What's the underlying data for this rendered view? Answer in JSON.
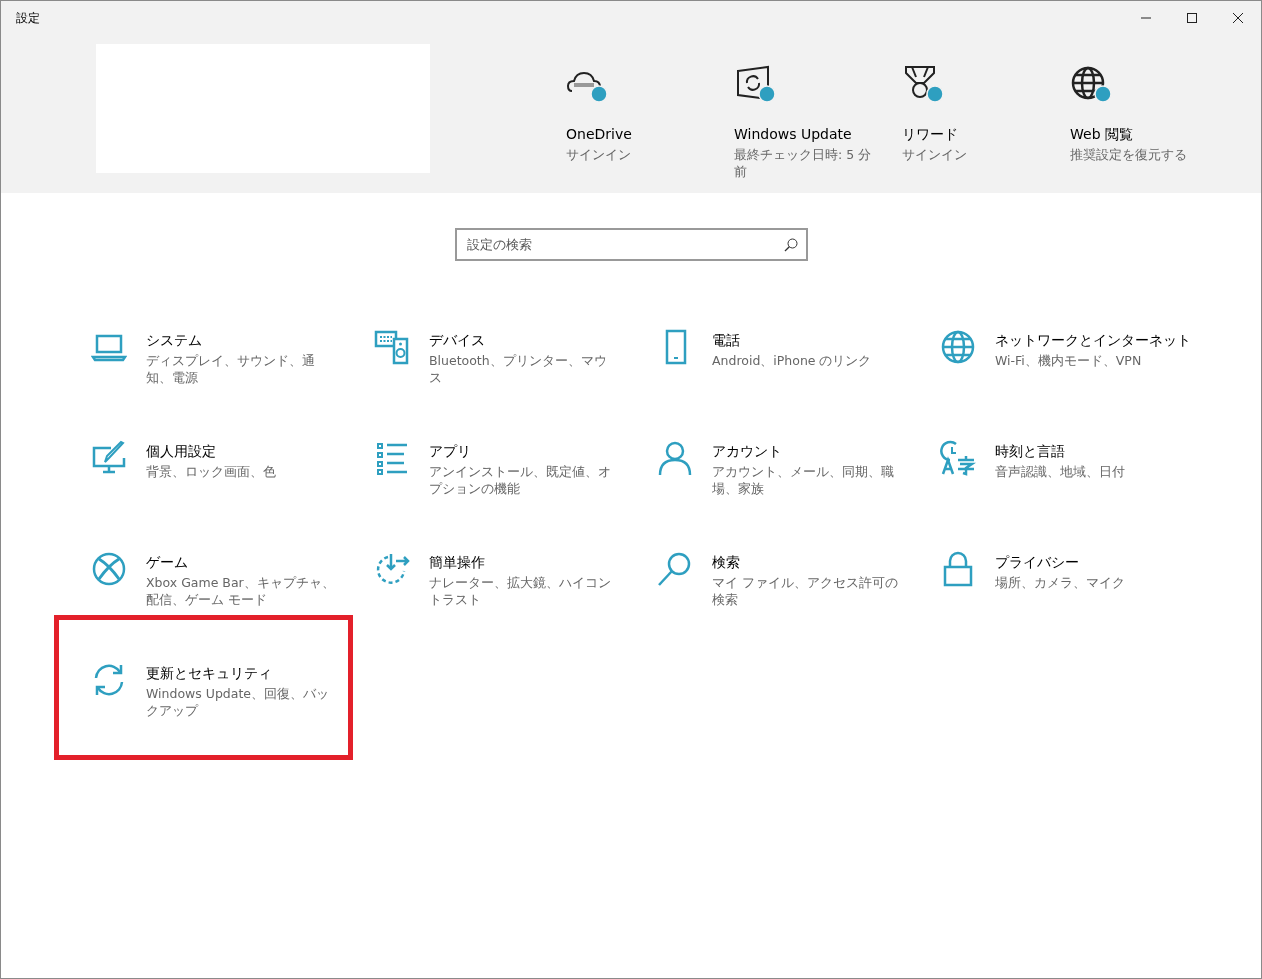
{
  "window": {
    "title": "設定"
  },
  "header_tiles": [
    {
      "kind": "cloud",
      "title": "OneDrive",
      "subtitle": "サインイン"
    },
    {
      "kind": "update",
      "title": "Windows Update",
      "subtitle": "最終チェック日時: 5 分前"
    },
    {
      "kind": "medal",
      "title": "リワード",
      "subtitle": "サインイン"
    },
    {
      "kind": "globe",
      "title": "Web 閲覧",
      "subtitle": "推奨設定を復元する"
    }
  ],
  "search": {
    "placeholder": "設定の検索"
  },
  "categories": [
    {
      "kind": "laptop",
      "title": "システム",
      "subtitle": "ディスプレイ、サウンド、通知、電源",
      "highlighted": false
    },
    {
      "kind": "devices",
      "title": "デバイス",
      "subtitle": "Bluetooth、プリンター、マウス",
      "highlighted": false
    },
    {
      "kind": "phone",
      "title": "電話",
      "subtitle": "Android、iPhone のリンク",
      "highlighted": false
    },
    {
      "kind": "globe",
      "title": "ネットワークとインターネット",
      "subtitle": "Wi-Fi、機内モード、VPN",
      "highlighted": false
    },
    {
      "kind": "paint",
      "title": "個人用設定",
      "subtitle": "背景、ロック画面、色",
      "highlighted": false
    },
    {
      "kind": "list",
      "title": "アプリ",
      "subtitle": "アンインストール、既定値、オプションの機能",
      "highlighted": false
    },
    {
      "kind": "person",
      "title": "アカウント",
      "subtitle": "アカウント、メール、同期、職場、家族",
      "highlighted": false
    },
    {
      "kind": "language",
      "title": "時刻と言語",
      "subtitle": "音声認識、地域、日付",
      "highlighted": false
    },
    {
      "kind": "xbox",
      "title": "ゲーム",
      "subtitle": "Xbox Game Bar、キャプチャ、配信、ゲーム モード",
      "highlighted": false
    },
    {
      "kind": "ease",
      "title": "簡単操作",
      "subtitle": "ナレーター、拡大鏡、ハイコントラスト",
      "highlighted": false
    },
    {
      "kind": "search",
      "title": "検索",
      "subtitle": "マイ ファイル、アクセス許可の検索",
      "highlighted": false
    },
    {
      "kind": "lock",
      "title": "プライバシー",
      "subtitle": "場所、カメラ、マイク",
      "highlighted": false
    },
    {
      "kind": "sync",
      "title": "更新とセキュリティ",
      "subtitle": "Windows Update、回復、バックアップ",
      "highlighted": true
    }
  ]
}
